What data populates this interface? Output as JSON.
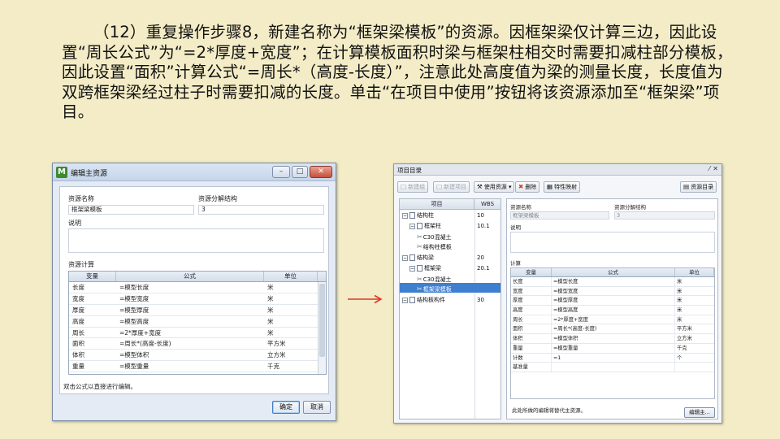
{
  "paragraph": "（12）重复操作步骤8，新建名称为“框架梁模板”的资源。因框架梁仅计算三边，因此设置“周长公式”为“=2*厚度+宽度”；在计算模板面积时梁与框架柱相交时需要扣减柱部分模板，因此设置“面积”计算公式“=周长*（高度-长度）”，注意此处高度值为梁的测量长度，长度值为双跨框架梁经过柱子时需要扣减的长度。单击“在项目中使用”按钮将该资源添加至“框架梁”项目。",
  "dialog": {
    "title": "编辑主资源",
    "app_icon": "M",
    "resource_name_label": "资源名称",
    "resource_name_value": "框架梁模板",
    "breakdown_label": "资源分解结构",
    "breakdown_value": "3",
    "description_label": "说明",
    "calc_label": "资源计算",
    "columns": [
      "变量",
      "公式",
      "单位"
    ],
    "rows": [
      [
        "长度",
        "=模型长度",
        "米"
      ],
      [
        "宽度",
        "=模型宽度",
        "米"
      ],
      [
        "厚度",
        "=模型厚度",
        "米"
      ],
      [
        "高度",
        "=模型高度",
        "米"
      ],
      [
        "周长",
        "=2*厚度+宽度",
        "米"
      ],
      [
        "面积",
        "=周长*(高度-长度)",
        "平方米"
      ],
      [
        "体积",
        "=模型体积",
        "立方米"
      ],
      [
        "重量",
        "=模型重量",
        "千克"
      ]
    ],
    "hint": "双击公式以直接进行编辑。",
    "ok_label": "确定",
    "cancel_label": "取消"
  },
  "panel": {
    "title": "项目目录",
    "toolbar": {
      "new_group": "新建组",
      "new_item": "新建项目",
      "use_resource": "使用资源",
      "delete": "删除",
      "property_mapping": "特性映射",
      "resource_catalog": "资源目录"
    },
    "tree_columns": [
      "项目",
      "WBS"
    ],
    "tree": [
      {
        "label": "结构柱",
        "wbs": "10"
      },
      {
        "label": "框架柱",
        "wbs": "10.1"
      },
      {
        "label": "C30混凝土",
        "wbs": ""
      },
      {
        "label": "结构柱模板",
        "wbs": ""
      },
      {
        "label": "结构梁",
        "wbs": "20"
      },
      {
        "label": "框架梁",
        "wbs": "20.1"
      },
      {
        "label": "C30混凝土",
        "wbs": ""
      },
      {
        "label": "框架梁模板",
        "wbs": ""
      },
      {
        "label": "结构板构件",
        "wbs": "30"
      }
    ],
    "resource_name_label": "资源名称",
    "resource_name_value": "框架梁模板",
    "breakdown_label": "资源分解结构",
    "breakdown_value": "3",
    "description_label": "说明",
    "calc_label": "计算",
    "columns": [
      "变量",
      "公式",
      "单位"
    ],
    "rows": [
      [
        "长度",
        "=模型长度",
        "米"
      ],
      [
        "宽度",
        "=模型宽度",
        "米"
      ],
      [
        "厚度",
        "=模型厚度",
        "米"
      ],
      [
        "高度",
        "=模型高度",
        "米"
      ],
      [
        "周长",
        "=2*厚度+宽度",
        "米"
      ],
      [
        "面积",
        "=周长*(高度-长度)",
        "平方米"
      ],
      [
        "体积",
        "=模型体积",
        "立方米"
      ],
      [
        "重量",
        "=模型重量",
        "千克"
      ],
      [
        "计数",
        "=1",
        "个"
      ],
      [
        "基准量",
        "",
        ""
      ]
    ],
    "footer": "此处所做的编辑将替代主资源。",
    "edit_master_button": "编辑主..."
  },
  "colors": {
    "background": "#f3ecc6",
    "arrow": "#e0342a",
    "selection": "#3f7fd0"
  }
}
